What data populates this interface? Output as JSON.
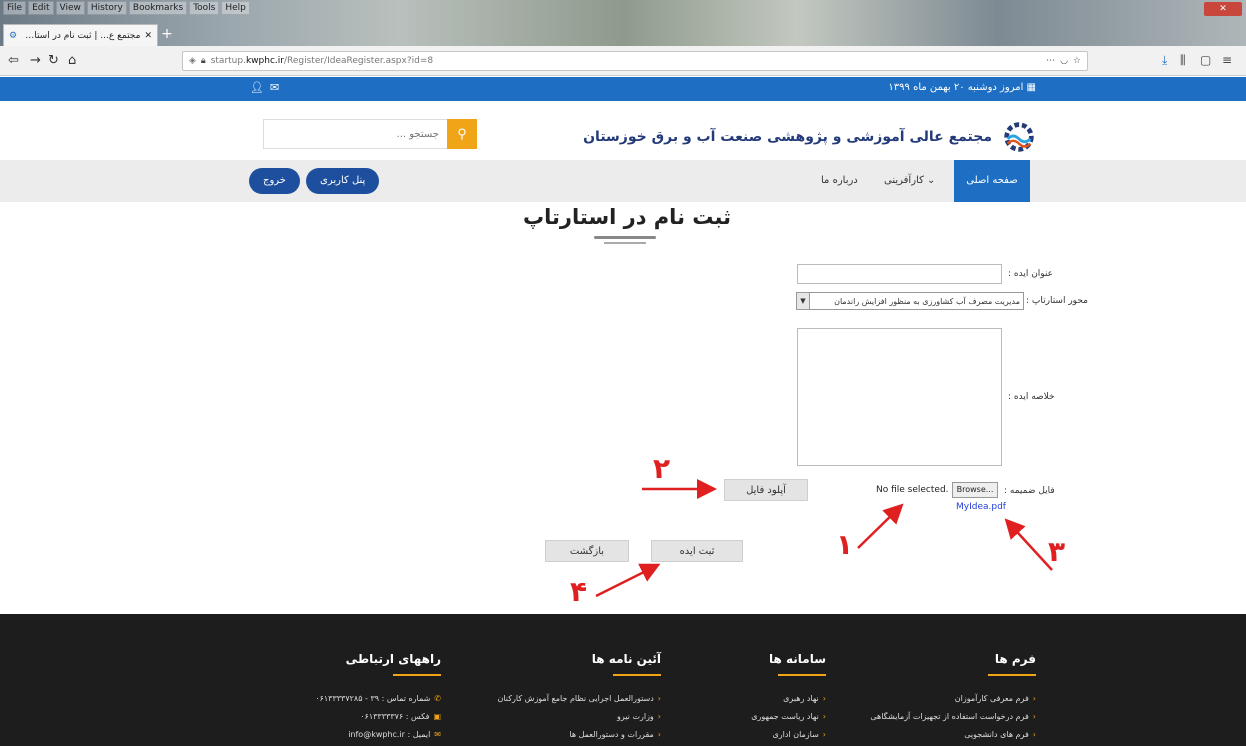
{
  "browser": {
    "menu": [
      "File",
      "Edit",
      "View",
      "History",
      "Bookmarks",
      "Tools",
      "Help"
    ],
    "tab_title": "مجتمع ع... | ثبت نام در استارتاپ",
    "url_prefix": "startup.",
    "url_domain": "kwphc.ir",
    "url_path": "/Register/IdeaRegister.aspx?id=8",
    "close_label": "✕"
  },
  "site": {
    "topbar_date": "امروز دوشنبه ۲۰ بهمن ماه ۱۳۹۹",
    "name": "مجتمع عالی آموزشی و پژوهشی صنعت آب و برق خوزستان",
    "search_placeholder": "جستجو ..."
  },
  "nav": {
    "home": "صفحه اصلی",
    "entrepreneurship": "کارآفرینی",
    "about": "درباره ما",
    "gallery": "پنل کاربری",
    "logout": "خروج"
  },
  "form": {
    "title": "ثبت نام در استارتاپ",
    "idea_title_label": "عنوان ایده :",
    "axis_label": "محور استارتاپ :",
    "axis_value": "مدیریت مصرف آب کشاورزی به منظور افزایش راندمان",
    "summary_label": "خلاصه ایده :",
    "file_label": "فایل ضمیمه :",
    "browse_label": "Browse...",
    "file_status": "No file selected.",
    "file_link": "MyIdea.pdf",
    "upload_label": "آپلود فایل",
    "submit_label": "ثبت ایده",
    "back_label": "بازگشت"
  },
  "annotations": [
    "۱",
    "۲",
    "۳",
    "۴"
  ],
  "footer": {
    "forms_title": "فرم ها",
    "forms": [
      "فرم معرفی کارآموزان",
      "فرم درخواست استفاده از تجهیزات آزمایشگاهی",
      "فرم های دانشجویی"
    ],
    "systems_title": "سامانه ها",
    "systems": [
      "نهاد رهبری",
      "نهاد ریاست جمهوری",
      "سازمان اداری"
    ],
    "rules_title": "آئین نامه ها",
    "rules": [
      "دستورالعمل اجرایی نظام جامع آموزش کارکنان",
      "وزارت نیرو",
      "مقررات و دستورالعمل ها"
    ],
    "contact_title": "راههای ارتباطی",
    "contact": [
      "شماره تماس : ۳۹ - ۰۶۱۳۳۳۳۷۲۸۵",
      "فکس : ۰۶۱۳۳۳۳۳۷۶",
      "ایمیل : info@kwphc.ir"
    ]
  }
}
